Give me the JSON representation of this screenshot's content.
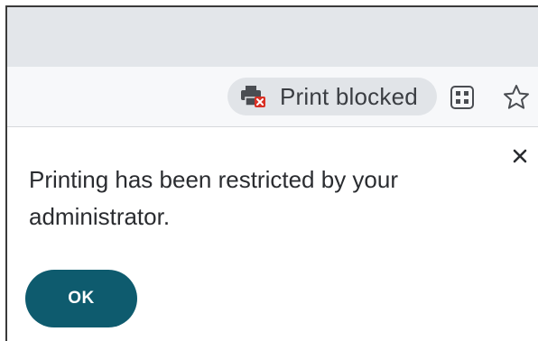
{
  "toolbar": {
    "print_chip": {
      "label": "Print blocked",
      "icon": "printer-blocked-icon"
    },
    "qr_icon": "qr-code-icon",
    "bookmark_icon": "star-icon"
  },
  "dialog": {
    "message": "Printing has been restricted by your administrator.",
    "ok_label": "OK",
    "close_icon": "close-icon"
  },
  "colors": {
    "tabstrip_bg": "#e3e6ea",
    "toolbar_bg": "#f7f8fa",
    "chip_bg": "#e1e4e8",
    "ok_button_bg": "#0e5b6e",
    "blocked_badge": "#d93025"
  }
}
